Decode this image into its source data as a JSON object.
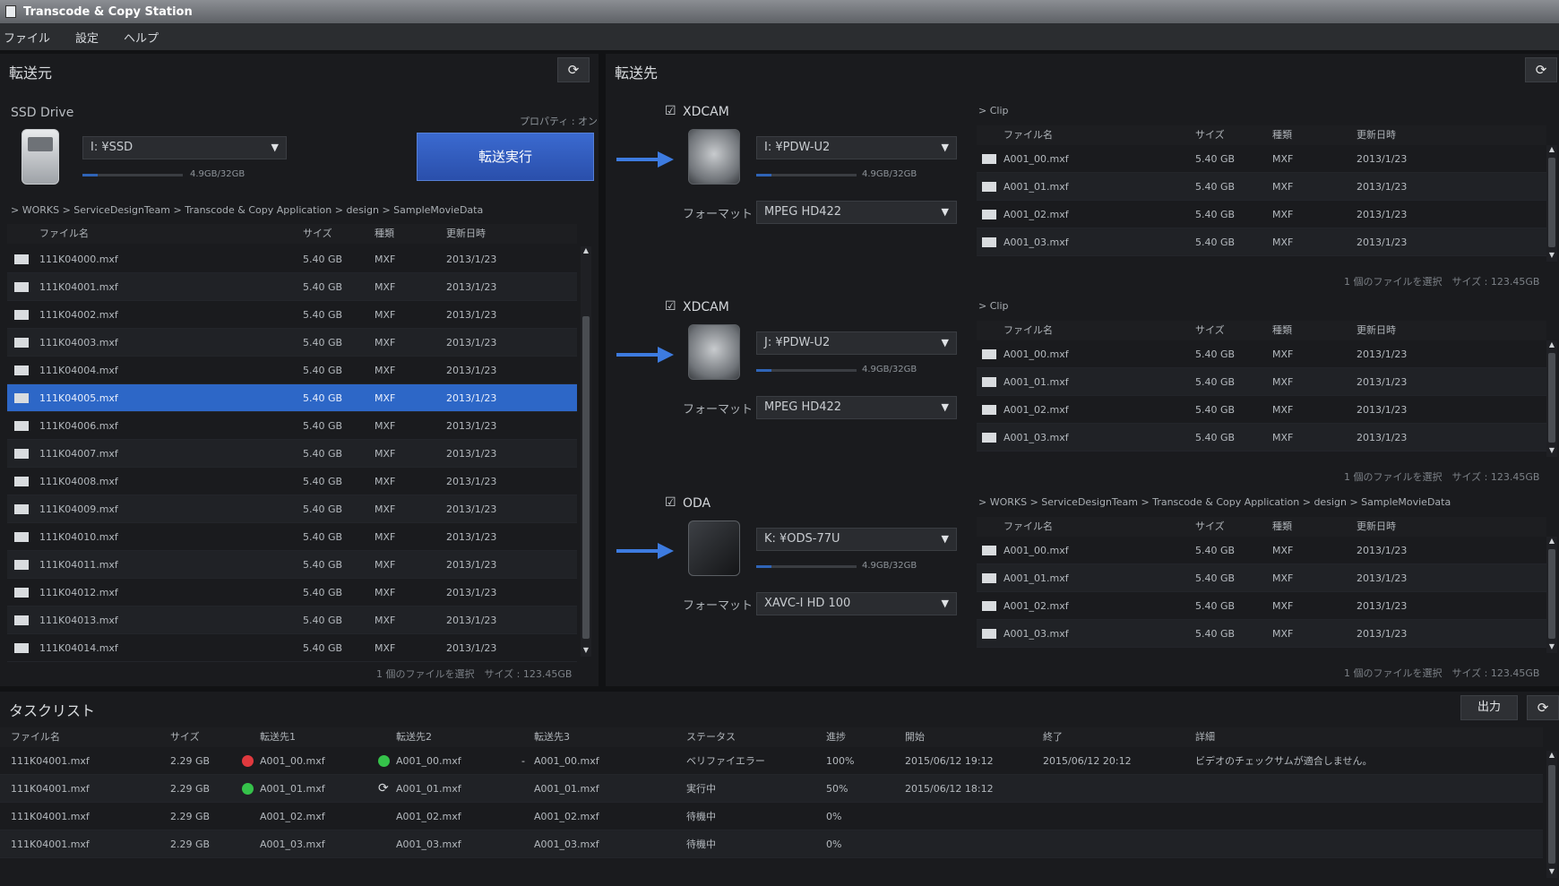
{
  "window": {
    "title": "Transcode & Copy Station"
  },
  "menu": [
    "ファイル",
    "設定",
    "ヘルプ"
  ],
  "source": {
    "title": "転送元",
    "drive_label": "SSD Drive",
    "property_label": "プロパティ : オン",
    "drive_select": "I: ¥SSD",
    "capacity": "4.9GB/32GB",
    "capacity_fill": 0.15,
    "run_button": "転送実行",
    "breadcrumb": "> WORKS > ServiceDesignTeam > Transcode & Copy Application > design > SampleMovieData",
    "columns": [
      "ファイル名",
      "サイズ",
      "種類",
      "更新日時"
    ],
    "rows": [
      [
        "111K04000.mxf",
        "5.40 GB",
        "MXF",
        "2013/1/23"
      ],
      [
        "111K04001.mxf",
        "5.40 GB",
        "MXF",
        "2013/1/23"
      ],
      [
        "111K04002.mxf",
        "5.40 GB",
        "MXF",
        "2013/1/23"
      ],
      [
        "111K04003.mxf",
        "5.40 GB",
        "MXF",
        "2013/1/23"
      ],
      [
        "111K04004.mxf",
        "5.40 GB",
        "MXF",
        "2013/1/23"
      ],
      [
        "111K04005.mxf",
        "5.40 GB",
        "MXF",
        "2013/1/23"
      ],
      [
        "111K04006.mxf",
        "5.40 GB",
        "MXF",
        "2013/1/23"
      ],
      [
        "111K04007.mxf",
        "5.40 GB",
        "MXF",
        "2013/1/23"
      ],
      [
        "111K04008.mxf",
        "5.40 GB",
        "MXF",
        "2013/1/23"
      ],
      [
        "111K04009.mxf",
        "5.40 GB",
        "MXF",
        "2013/1/23"
      ],
      [
        "111K04010.mxf",
        "5.40 GB",
        "MXF",
        "2013/1/23"
      ],
      [
        "111K04011.mxf",
        "5.40 GB",
        "MXF",
        "2013/1/23"
      ],
      [
        "111K04012.mxf",
        "5.40 GB",
        "MXF",
        "2013/1/23"
      ],
      [
        "111K04013.mxf",
        "5.40 GB",
        "MXF",
        "2013/1/23"
      ],
      [
        "111K04014.mxf",
        "5.40 GB",
        "MXF",
        "2013/1/23"
      ]
    ],
    "footer": "1 個のファイルを選択　サイズ : 123.45GB"
  },
  "dest": {
    "title": "転送先",
    "format_label": "フォーマット",
    "devices": [
      {
        "name": "XDCAM",
        "select": "I: ¥PDW-U2",
        "capacity": "4.9GB/32GB",
        "format": "MPEG HD422",
        "crumb": "> Clip",
        "rows": [
          [
            "A001_00.mxf",
            "5.40 GB",
            "MXF",
            "2013/1/23"
          ],
          [
            "A001_01.mxf",
            "5.40 GB",
            "MXF",
            "2013/1/23"
          ],
          [
            "A001_02.mxf",
            "5.40 GB",
            "MXF",
            "2013/1/23"
          ],
          [
            "A001_03.mxf",
            "5.40 GB",
            "MXF",
            "2013/1/23"
          ]
        ],
        "footer": "1 個のファイルを選択　サイズ : 123.45GB"
      },
      {
        "name": "XDCAM",
        "select": "J: ¥PDW-U2",
        "capacity": "4.9GB/32GB",
        "format": "MPEG HD422",
        "crumb": "> Clip",
        "rows": [
          [
            "A001_00.mxf",
            "5.40 GB",
            "MXF",
            "2013/1/23"
          ],
          [
            "A001_01.mxf",
            "5.40 GB",
            "MXF",
            "2013/1/23"
          ],
          [
            "A001_02.mxf",
            "5.40 GB",
            "MXF",
            "2013/1/23"
          ],
          [
            "A001_03.mxf",
            "5.40 GB",
            "MXF",
            "2013/1/23"
          ]
        ],
        "footer": "1 個のファイルを選択　サイズ : 123.45GB"
      },
      {
        "name": "ODA",
        "select": "K: ¥ODS-77U",
        "capacity": "4.9GB/32GB",
        "format": "XAVC-I HD 100",
        "crumb": "> WORKS > ServiceDesignTeam > Transcode & Copy Application > design > SampleMovieData",
        "rows": [
          [
            "A001_00.mxf",
            "5.40 GB",
            "MXF",
            "2013/1/23"
          ],
          [
            "A001_01.mxf",
            "5.40 GB",
            "MXF",
            "2013/1/23"
          ],
          [
            "A001_02.mxf",
            "5.40 GB",
            "MXF",
            "2013/1/23"
          ],
          [
            "A001_03.mxf",
            "5.40 GB",
            "MXF",
            "2013/1/23"
          ]
        ],
        "footer": "1 個のファイルを選択　サイズ : 123.45GB"
      }
    ],
    "columns": [
      "ファイル名",
      "サイズ",
      "種類",
      "更新日時"
    ]
  },
  "tasks": {
    "title": "タスクリスト",
    "output_button": "出力",
    "columns": [
      "ファイル名",
      "サイズ",
      "転送先1",
      "転送先2",
      "転送先3",
      "ステータス",
      "進捗",
      "開始",
      "終了",
      "詳細"
    ],
    "rows": [
      {
        "file": "111K04001.mxf",
        "size": "2.29 GB",
        "d1": "A001_00.mxf",
        "d1s": "red",
        "d2": "A001_00.mxf",
        "d2s": "green",
        "d3": "A001_00.mxf",
        "d3s": "dash",
        "status": "ベリファイエラー",
        "progress": "100%",
        "start": "2015/06/12 19:12",
        "end": "2015/06/12 20:12",
        "detail": "ビデオのチェックサムが適合しません。"
      },
      {
        "file": "111K04001.mxf",
        "size": "2.29 GB",
        "d1": "A001_01.mxf",
        "d1s": "green",
        "d2": "A001_01.mxf",
        "d2s": "sync",
        "d3": "A001_01.mxf",
        "d3s": "",
        "status": "実行中",
        "progress": "50%",
        "start": "2015/06/12 18:12",
        "end": "",
        "detail": ""
      },
      {
        "file": "111K04001.mxf",
        "size": "2.29 GB",
        "d1": "A001_02.mxf",
        "d1s": "",
        "d2": "A001_02.mxf",
        "d2s": "",
        "d3": "A001_02.mxf",
        "d3s": "",
        "status": "待機中",
        "progress": "0%",
        "start": "",
        "end": "",
        "detail": ""
      },
      {
        "file": "111K04001.mxf",
        "size": "2.29 GB",
        "d1": "A001_03.mxf",
        "d1s": "",
        "d2": "A001_03.mxf",
        "d2s": "",
        "d3": "A001_03.mxf",
        "d3s": "",
        "status": "待機中",
        "progress": "0%",
        "start": "",
        "end": "",
        "detail": ""
      }
    ]
  },
  "colors": {
    "accent": "#2d67c7",
    "error": "#e0393e",
    "ok": "#35c24a"
  }
}
